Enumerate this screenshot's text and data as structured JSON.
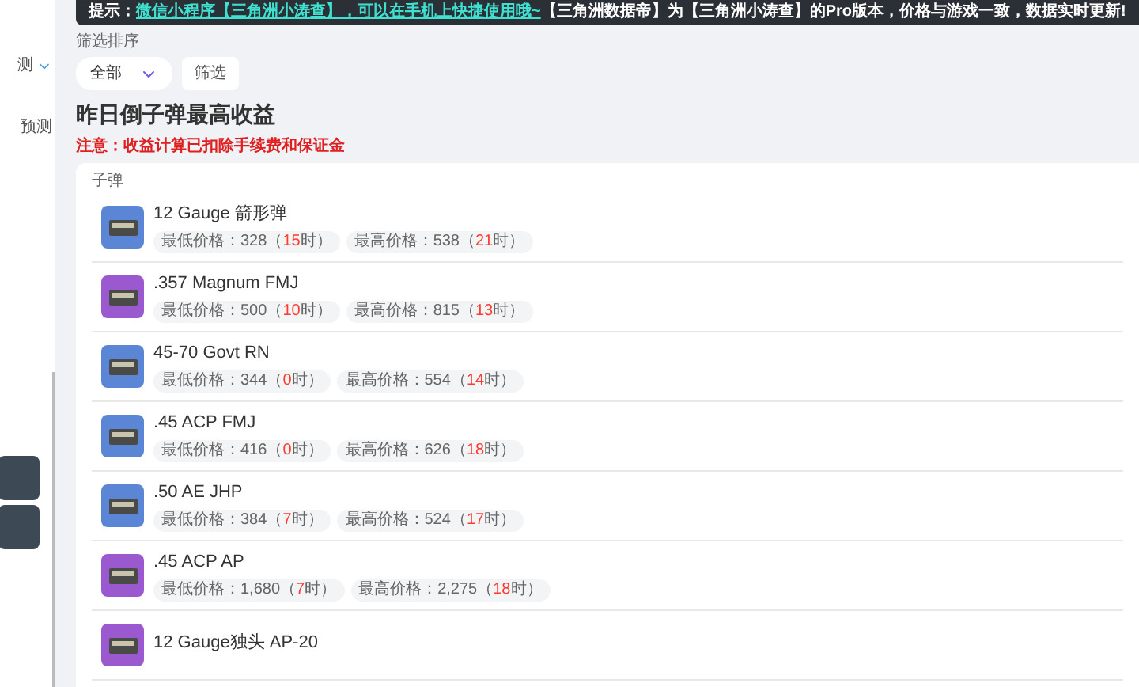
{
  "sidebar": {
    "items": [
      {
        "label": "测",
        "expanded": true
      },
      {
        "label": "预测"
      }
    ]
  },
  "banner": {
    "prefix": "提示：",
    "link": "微信小程序【三角洲小涛查】，可以在手机上快捷使用哦~",
    "text": "【三角洲数据帝】为【三角洲小涛查】的Pro版本，价格与游戏一致，数据实时更新!"
  },
  "filter": {
    "label": "筛选排序",
    "select_value": "全部",
    "button": "筛选"
  },
  "title": "昨日倒子弹最高收益",
  "warning": "注意：收益计算已扣除手续费和保证金",
  "card": {
    "category": "子弹",
    "items": [
      {
        "name": "12 Gauge 箭形弹",
        "color": "#5b86d6",
        "prices": [
          {
            "label": "最低价格：328（",
            "hour": "15",
            "suffix": "时）"
          },
          {
            "label": "最高价格：538（",
            "hour": "21",
            "suffix": "时）"
          }
        ]
      },
      {
        "name": ".357 Magnum FMJ",
        "color": "#9b59d0",
        "prices": [
          {
            "label": "最低价格：500（",
            "hour": "10",
            "suffix": "时）"
          },
          {
            "label": "最高价格：815（",
            "hour": "13",
            "suffix": "时）"
          }
        ]
      },
      {
        "name": "45-70 Govt RN",
        "color": "#5b86d6",
        "prices": [
          {
            "label": "最低价格：344（",
            "hour": "0",
            "suffix": "时）"
          },
          {
            "label": "最高价格：554（",
            "hour": "14",
            "suffix": "时）"
          }
        ]
      },
      {
        "name": ".45 ACP FMJ",
        "color": "#5b86d6",
        "prices": [
          {
            "label": "最低价格：416（",
            "hour": "0",
            "suffix": "时）"
          },
          {
            "label": "最高价格：626（",
            "hour": "18",
            "suffix": "时）"
          }
        ]
      },
      {
        "name": ".50 AE JHP",
        "color": "#5b86d6",
        "prices": [
          {
            "label": "最低价格：384（",
            "hour": "7",
            "suffix": "时）"
          },
          {
            "label": "最高价格：524（",
            "hour": "17",
            "suffix": "时）"
          }
        ]
      },
      {
        "name": ".45 ACP AP",
        "color": "#9b59d0",
        "prices": [
          {
            "label": "最低价格：1,680（",
            "hour": "7",
            "suffix": "时）"
          },
          {
            "label": "最高价格：2,275（",
            "hour": "18",
            "suffix": "时）"
          }
        ]
      },
      {
        "name": "12 Gauge独头 AP-20",
        "color": "#9b59d0"
      }
    ]
  }
}
